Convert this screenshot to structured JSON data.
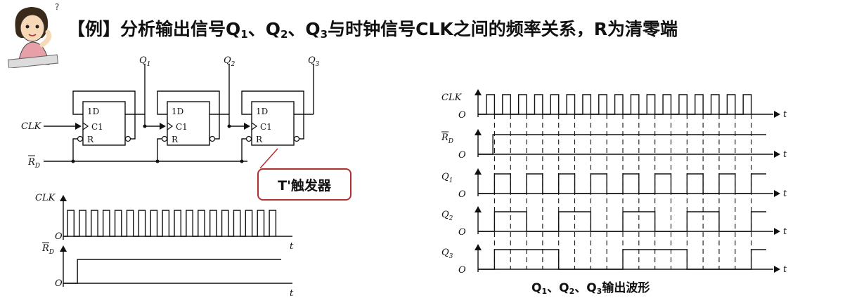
{
  "title": {
    "prefix": "【例】分析输出信号Q",
    "sub1": "1",
    "sep1": "、Q",
    "sub2": "2",
    "sep2": "、Q",
    "sub3": "3",
    "suffix": "与时钟信号CLK之间的频率关系，R为清零端"
  },
  "circuit": {
    "clk_label": "CLK",
    "rd_label": "R",
    "rd_sub": "D",
    "ff_labels": {
      "d": "1D",
      "c": "C1",
      "r": "R"
    },
    "outputs": [
      {
        "name": "Q",
        "sub": "1"
      },
      {
        "name": "Q",
        "sub": "2"
      },
      {
        "name": "Q",
        "sub": "3"
      }
    ]
  },
  "callout": {
    "text": "T'触发器"
  },
  "left_waveform": {
    "clk_label": "CLK",
    "rd_label": "R",
    "rd_sub": "D",
    "origin": "O",
    "t_label": "t",
    "clk_pulses": 18,
    "rd_rise_fraction": 0.065
  },
  "right_waveform": {
    "caption": {
      "q": "Q",
      "s1": "1",
      "sep1": "、Q",
      "s2": "2",
      "sep2": "、Q",
      "s3": "3",
      "suffix": "输出波形"
    },
    "origin": "O",
    "t_label": "t",
    "clk_periods": 17,
    "rows": [
      {
        "name": "CLK",
        "sub": "",
        "divider": 0
      },
      {
        "name": "R",
        "sub": "D",
        "divider": -1
      },
      {
        "name": "Q",
        "sub": "1",
        "divider": 2
      },
      {
        "name": "Q",
        "sub": "2",
        "divider": 4
      },
      {
        "name": "Q",
        "sub": "3",
        "divider": 8
      }
    ]
  }
}
